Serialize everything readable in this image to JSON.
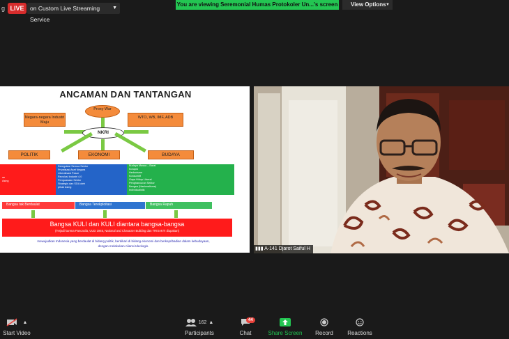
{
  "topbar": {
    "rec_label": "g",
    "live_badge": "LIVE",
    "live_service": "on Custom Live Streaming Service",
    "viewing_banner": "You are viewing Seremonial Humas Protokoler Un...'s screen",
    "view_options": "View Options"
  },
  "slide": {
    "title": "ANCAMAN DAN TANTANGAN",
    "proxy": "Proxy War",
    "negara": "Negara-negara Industri Maju",
    "wto": "WTO, WB, IMF, ADB",
    "nkri": "NKRI",
    "politik": "POLITIK",
    "ekonomi": "EKONOMI",
    "budaya": "BUDAYA",
    "red_lines": [
      "an",
      "Asing"
    ],
    "blue_lines": [
      "Deregulasi Semua Sektor",
      "Privatisasi Aset Negara",
      "Liberalisasi Pasar",
      "Revolusi Industri 4.0",
      "Penguasaan Sektor",
      "Strategis dan SDA oleh",
      "pihak Asing"
    ],
    "green_lines": [
      "Budaya Massa – Barat",
      "Korupsi",
      "Hedonisme",
      "Konsumtif",
      "Gaya Hidup Liberal",
      "Penghancuran Sektor",
      "Bangsa (Nasionalisme)",
      "Individualistik"
    ],
    "strip_red": "Bangsa tak Berdaulat",
    "strip_blue": "Bangsa Terekploitasi",
    "strip_green": "Bangsa Rapuh",
    "bangsa_main": "Bangsa KULI dan KULI diantara bangsa-bangsa",
    "bangsa_sub": "(Terjadi karena Pancasila, UUD 1945, National and Character Building dan TRISAKTI diupakan)",
    "footnote_1": "mewujudkan Indonesia yang berdaulat di bidang politik, berdikari di bidang ekonomi dan berkepribadian dalam kebudayaan,",
    "footnote_2": "dengan melakukan Aliansi Ideologis."
  },
  "video": {
    "name": "A-141 Djarot Saiful H"
  },
  "toolbar": {
    "start_video": "Start Video",
    "participants_count": "162",
    "participants": "Participants",
    "chat_badge": "44",
    "chat": "Chat",
    "share_screen": "Share Screen",
    "record": "Record",
    "reactions": "Reactions"
  },
  "colors": {
    "live": "#d72c2c",
    "banner": "#23c552",
    "share": "#23c552",
    "slide_red": "#ff1b1b",
    "slide_blue": "#2464c8",
    "slide_green": "#24b14c",
    "slide_orange": "#f48b3b"
  }
}
